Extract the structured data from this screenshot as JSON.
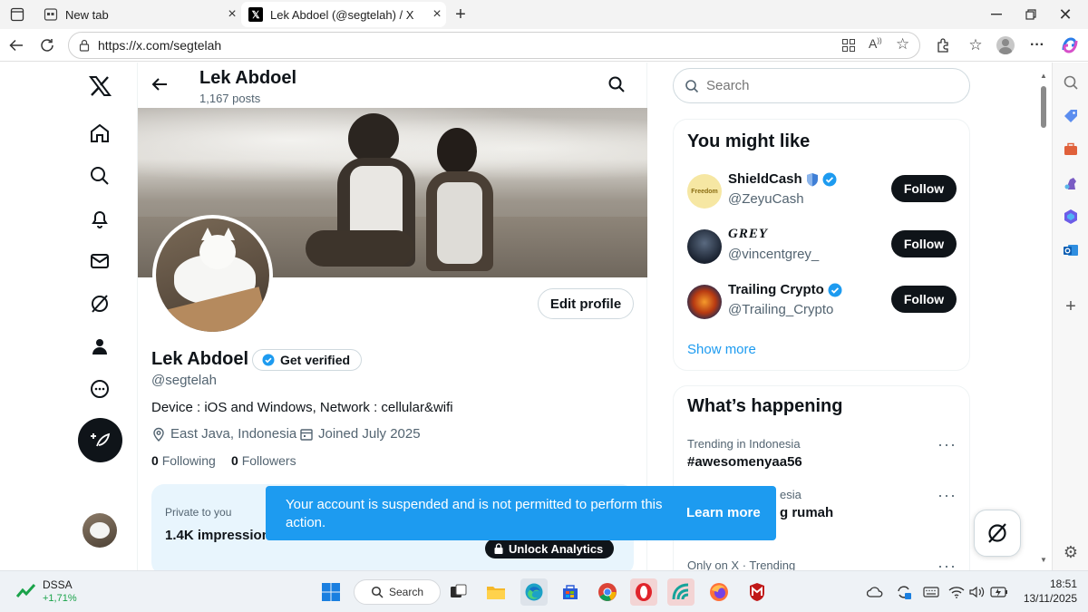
{
  "browser": {
    "tabs": [
      {
        "label": "New tab"
      },
      {
        "label": "Lek Abdoel (@segtelah) / X"
      }
    ],
    "url": "https://x.com/segtelah"
  },
  "header": {
    "name": "Lek Abdoel",
    "posts": "1,167 posts"
  },
  "profile": {
    "name": "Lek Abdoel",
    "get_verified": "Get verified",
    "handle": "@segtelah",
    "bio": "Device : iOS and Windows, Network : cellular&wifi",
    "location": "East Java, Indonesia",
    "joined": "Joined July 2025",
    "following_count": "0",
    "following_label": "Following",
    "followers_count": "0",
    "followers_label": "Followers",
    "edit_profile": "Edit profile"
  },
  "analytics": {
    "private_label": "Private to you",
    "impressions": "1.4K impressions",
    "unlock": "Unlock Analytics"
  },
  "toast": {
    "message": "Your account is suspended and is not permitted to perform this action.",
    "learn_more": "Learn more"
  },
  "right": {
    "search_placeholder": "Search",
    "you_might_like": "You might like",
    "suggestions": [
      {
        "name": "ShieldCash",
        "handle": "@ZeyuCash",
        "avatar_text": "Freedom"
      },
      {
        "name": "GREY",
        "handle": "@vincentgrey_"
      },
      {
        "name": "Trailing Crypto",
        "handle": "@Trailing_Crypto"
      }
    ],
    "follow_label": "Follow",
    "show_more": "Show more",
    "whats_happening": "What’s happening",
    "trends": [
      {
        "label": "Trending in Indonesia",
        "value": "#awesomenyaa56"
      },
      {
        "label": "esia",
        "value": "g rumah"
      },
      {
        "label": "Only on X · Trending",
        "value": ""
      }
    ]
  },
  "taskbar": {
    "stock_name": "DSSA",
    "stock_change": "+1,71%",
    "search_label": "Search",
    "time": "18:51",
    "date": "13/11/2025"
  },
  "colors": {
    "accent": "#1d9bf0",
    "toast": "#1d9bf0",
    "text": "#0f1419",
    "muted": "#536471"
  }
}
